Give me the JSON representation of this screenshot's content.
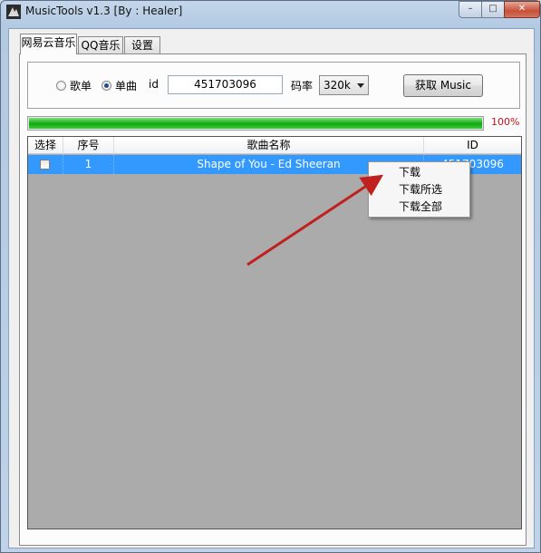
{
  "window": {
    "title": "MusicTools v1.3 [By : Healer]",
    "icon": "app-icon",
    "controls": {
      "minimize": "–",
      "maximize": "□",
      "close": "✕"
    }
  },
  "tabs": [
    {
      "label": "网易云音乐",
      "active": true
    },
    {
      "label": "QQ音乐",
      "active": false
    },
    {
      "label": "设置",
      "active": false
    }
  ],
  "options": {
    "radio_playlist": "歌单",
    "radio_single": "单曲",
    "selected_mode": "单曲",
    "id_label": "id",
    "id_value": "451703096",
    "bitrate_label": "码率",
    "bitrate_value": "320k",
    "fetch_button": "获取 Music"
  },
  "progress": {
    "value": 1.0,
    "text": "100%",
    "color": "#22b322"
  },
  "table": {
    "columns": [
      "选择",
      "序号",
      "歌曲名称",
      "ID"
    ],
    "rows": [
      {
        "checked": false,
        "index": "1",
        "name": "Shape of You - Ed Sheeran",
        "id": "451703096",
        "selected": true
      }
    ]
  },
  "context_menu": {
    "items": [
      "下载",
      "下载所选",
      "下载全部"
    ]
  },
  "colors": {
    "selection": "#3399ff",
    "progress_text": "#c0121e",
    "annotation_arrow": "#c0201e"
  }
}
